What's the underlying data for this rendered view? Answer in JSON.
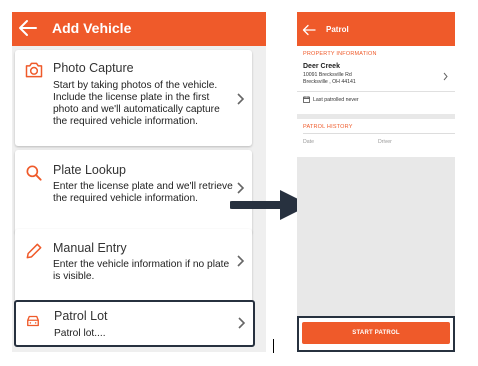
{
  "left_screen": {
    "header": {
      "title": "Add Vehicle",
      "back_icon": "arrow-left-icon"
    },
    "cards": [
      {
        "id": "photo",
        "icon": "camera-icon",
        "title": "Photo Capture",
        "description": "Start by taking photos of the vehicle. Include the license plate in the first photo and we'll automatically capture the required vehicle information."
      },
      {
        "id": "plate",
        "icon": "search-icon",
        "title": "Plate Lookup",
        "description": "Enter the license plate and we'll retrieve the required vehicle information."
      },
      {
        "id": "manual",
        "icon": "pencil-icon",
        "title": "Manual Entry",
        "description": "Enter the vehicle information if no plate is visible."
      },
      {
        "id": "patrol",
        "icon": "car-icon",
        "title": "Patrol Lot",
        "description": "Patrol lot...."
      }
    ]
  },
  "right_screen": {
    "header": {
      "title": "Patrol",
      "back_icon": "arrow-left-icon"
    },
    "property": {
      "section_title": "PROPERTY INFORMATION",
      "name": "Deer Creek",
      "address_line1": "10091 Brecksville Rd",
      "address_line2": "Brecksville , OH 44141",
      "last_patrolled": "Last patrolled never"
    },
    "history": {
      "section_title": "PATROL HISTORY",
      "columns": [
        "Date",
        "Driver"
      ]
    },
    "start_button": "START PATROL"
  },
  "colors": {
    "accent": "#ef5a2a",
    "highlight_border": "#27313f",
    "arrow": "#27313f"
  }
}
